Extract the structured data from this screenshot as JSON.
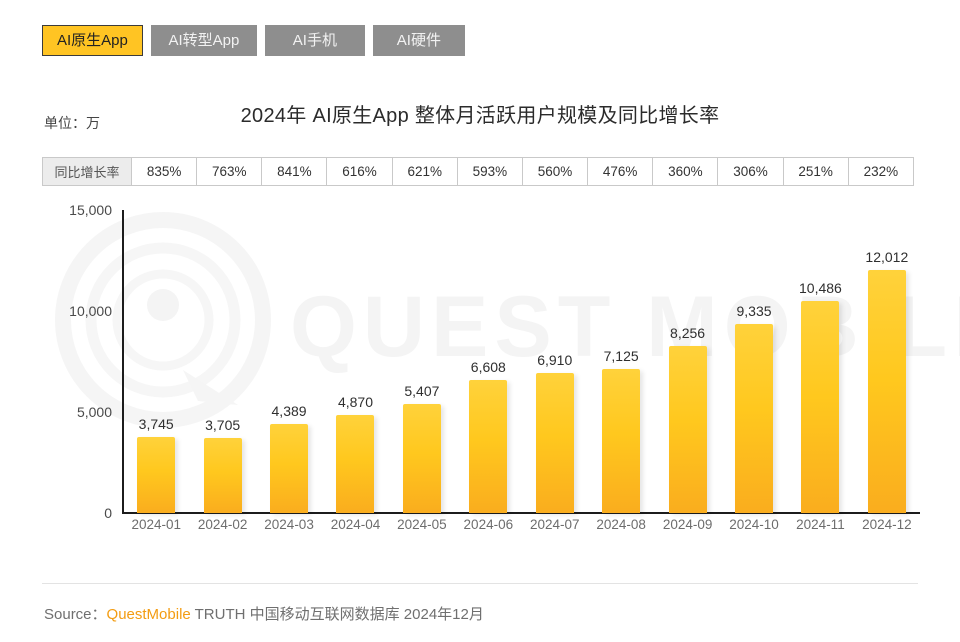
{
  "tabs": [
    {
      "label": "AI原生App",
      "active": true
    },
    {
      "label": "AI转型App",
      "active": false
    },
    {
      "label": "AI手机",
      "active": false
    },
    {
      "label": "AI硬件",
      "active": false
    }
  ],
  "unit_label": "单位：万",
  "title": "2024年 AI原生App 整体月活跃用户规模及同比增长率",
  "growth_table": {
    "header": "同比增长率",
    "values": [
      "835%",
      "763%",
      "841%",
      "616%",
      "621%",
      "593%",
      "560%",
      "476%",
      "360%",
      "306%",
      "251%",
      "232%"
    ]
  },
  "footer": {
    "source_prefix": "Source：",
    "brand": "QuestMobile",
    "source_rest": " TRUTH 中国移动互联网数据库 2024年12月"
  },
  "watermark": {
    "text": "QUEST MOBILE"
  },
  "colors": {
    "active_tab": "#FFC423",
    "inactive_tab": "#8e8e8e",
    "bar_top": "#FFD23B",
    "bar_bottom": "#FAAD1E",
    "brand_orange": "#F39C12"
  },
  "chart_data": {
    "type": "bar",
    "title": "2024年 AI原生App 整体月活跃用户规模及同比增长率",
    "xlabel": "",
    "ylabel": "单位：万",
    "ylim": [
      0,
      15000
    ],
    "yticks": [
      0,
      5000,
      10000,
      15000
    ],
    "ytick_labels": [
      "0",
      "5,000",
      "10,000",
      "15,000"
    ],
    "grid": false,
    "legend": "none",
    "categories": [
      "2024-01",
      "2024-02",
      "2024-03",
      "2024-04",
      "2024-05",
      "2024-06",
      "2024-07",
      "2024-08",
      "2024-09",
      "2024-10",
      "2024-11",
      "2024-12"
    ],
    "values": [
      3745,
      3705,
      4389,
      4870,
      5407,
      6608,
      6910,
      7125,
      8256,
      9335,
      10486,
      12012
    ],
    "value_labels": [
      "3,745",
      "3,705",
      "4,389",
      "4,870",
      "5,407",
      "6,608",
      "6,910",
      "7,125",
      "8,256",
      "9,335",
      "10,486",
      "12,012"
    ],
    "secondary_series": {
      "name": "同比增长率",
      "values": [
        835,
        763,
        841,
        616,
        621,
        593,
        560,
        476,
        360,
        306,
        251,
        232
      ],
      "labels": [
        "835%",
        "763%",
        "841%",
        "616%",
        "621%",
        "593%",
        "560%",
        "476%",
        "360%",
        "306%",
        "251%",
        "232%"
      ]
    }
  }
}
